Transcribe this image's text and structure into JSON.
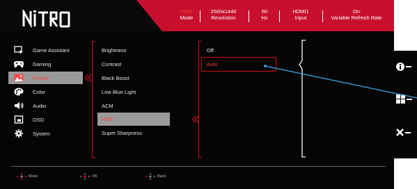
{
  "brand": {
    "logo_text": "NITRO",
    "accent": "#c8102e"
  },
  "status_bar": [
    {
      "value": "HDR",
      "label": "Mode",
      "highlight": true
    },
    {
      "value": "2560x1440",
      "label": "Resolution"
    },
    {
      "value": "60",
      "label": "Hz"
    },
    {
      "value": "HDMI1",
      "label": "Input"
    },
    {
      "value": "On",
      "label": "Variable Refresh Rate"
    }
  ],
  "menu": [
    {
      "label": "Game Assistant",
      "icon": "game-assistant-icon"
    },
    {
      "label": "Gaming",
      "icon": "gamepad-icon"
    },
    {
      "label": "Picture",
      "icon": "picture-icon",
      "selected": true
    },
    {
      "label": "Color",
      "icon": "palette-icon"
    },
    {
      "label": "Audio",
      "icon": "speaker-icon"
    },
    {
      "label": "OSD",
      "icon": "osd-icon"
    },
    {
      "label": "System",
      "icon": "gear-icon"
    }
  ],
  "submenu": [
    {
      "label": "Brightness"
    },
    {
      "label": "Contrast"
    },
    {
      "label": "Black Boost"
    },
    {
      "label": "Low Blue Light"
    },
    {
      "label": "ACM"
    },
    {
      "label": "HDR",
      "selected": true
    },
    {
      "label": "Super Sharpness"
    }
  ],
  "values": [
    {
      "label": "Off"
    },
    {
      "label": "Auto",
      "selected": true
    }
  ],
  "nav_hints": {
    "move": "Move",
    "ok": "OK",
    "back": "Back"
  },
  "side_buttons": [
    {
      "icon": "info-icon"
    },
    {
      "icon": "windows-grid-icon"
    },
    {
      "icon": "close-icon"
    }
  ]
}
